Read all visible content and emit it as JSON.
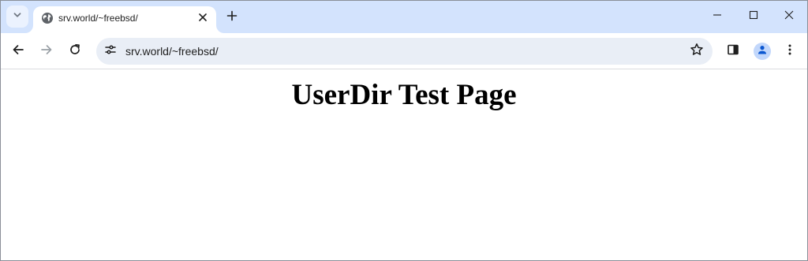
{
  "tab": {
    "title": "srv.world/~freebsd/"
  },
  "omnibox": {
    "url": "srv.world/~freebsd/"
  },
  "page": {
    "heading": "UserDir Test Page"
  },
  "icons": {
    "tab_search": "chevron-down-icon",
    "favicon": "globe-icon",
    "tab_close": "close-icon",
    "new_tab": "plus-icon",
    "minimize": "minimize-icon",
    "maximize": "maximize-icon",
    "close_window": "close-icon",
    "back": "arrow-left-icon",
    "forward": "arrow-right-icon",
    "reload": "reload-icon",
    "site_info": "tune-icon",
    "bookmark": "star-icon",
    "side_panel": "side-panel-icon",
    "profile": "person-icon",
    "menu": "kebab-menu-icon"
  },
  "colors": {
    "tabstrip_bg": "#d3e3fd",
    "omnibox_bg": "#e9eef6",
    "icon": "#1f1f1f",
    "disabled_icon": "#9aa0a6",
    "profile_accent": "#0b57d0"
  }
}
